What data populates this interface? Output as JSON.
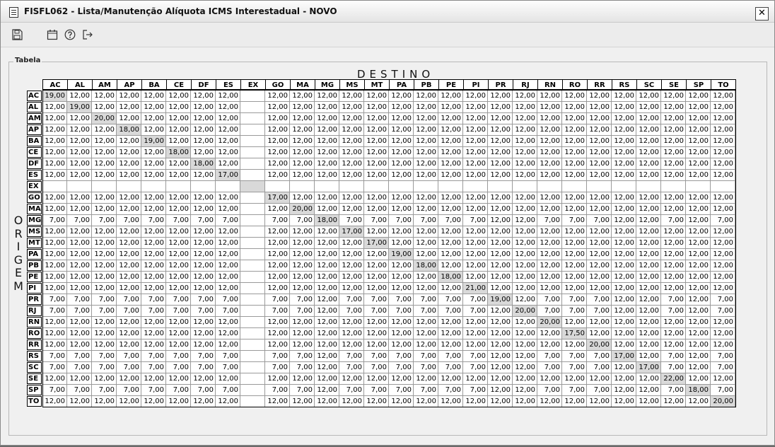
{
  "window": {
    "title": "FISFL062 - Lista/Manutenção Alíquota ICMS Interestadual - NOVO",
    "close_label": "✕"
  },
  "toolbar": {
    "icons": [
      "save-icon",
      "calendar-icon",
      "help-icon",
      "exit-icon"
    ]
  },
  "panel": {
    "legend": "Tabela",
    "destino_label": "DESTINO",
    "origem_letters": [
      "O",
      "R",
      "I",
      "G",
      "E",
      "M"
    ]
  },
  "states": [
    "AC",
    "AL",
    "AM",
    "AP",
    "BA",
    "CE",
    "DF",
    "ES",
    "EX",
    "GO",
    "MA",
    "MG",
    "MS",
    "MT",
    "PA",
    "PB",
    "PE",
    "PI",
    "PR",
    "RJ",
    "RN",
    "RO",
    "RR",
    "RS",
    "SC",
    "SE",
    "SP",
    "TO"
  ],
  "rows": [
    [
      "19,00",
      "12,00",
      "12,00",
      "12,00",
      "12,00",
      "12,00",
      "12,00",
      "12,00",
      "",
      "12,00",
      "12,00",
      "12,00",
      "12,00",
      "12,00",
      "12,00",
      "12,00",
      "12,00",
      "12,00",
      "12,00",
      "12,00",
      "12,00",
      "12,00",
      "12,00",
      "12,00",
      "12,00",
      "12,00",
      "12,00",
      "12,00"
    ],
    [
      "12,00",
      "19,00",
      "12,00",
      "12,00",
      "12,00",
      "12,00",
      "12,00",
      "12,00",
      "",
      "12,00",
      "12,00",
      "12,00",
      "12,00",
      "12,00",
      "12,00",
      "12,00",
      "12,00",
      "12,00",
      "12,00",
      "12,00",
      "12,00",
      "12,00",
      "12,00",
      "12,00",
      "12,00",
      "12,00",
      "12,00",
      "12,00"
    ],
    [
      "12,00",
      "12,00",
      "20,00",
      "12,00",
      "12,00",
      "12,00",
      "12,00",
      "12,00",
      "",
      "12,00",
      "12,00",
      "12,00",
      "12,00",
      "12,00",
      "12,00",
      "12,00",
      "12,00",
      "12,00",
      "12,00",
      "12,00",
      "12,00",
      "12,00",
      "12,00",
      "12,00",
      "12,00",
      "12,00",
      "12,00",
      "12,00"
    ],
    [
      "12,00",
      "12,00",
      "12,00",
      "18,00",
      "12,00",
      "12,00",
      "12,00",
      "12,00",
      "",
      "12,00",
      "12,00",
      "12,00",
      "12,00",
      "12,00",
      "12,00",
      "12,00",
      "12,00",
      "12,00",
      "12,00",
      "12,00",
      "12,00",
      "12,00",
      "12,00",
      "12,00",
      "12,00",
      "12,00",
      "12,00",
      "12,00"
    ],
    [
      "12,00",
      "12,00",
      "12,00",
      "12,00",
      "19,00",
      "12,00",
      "12,00",
      "12,00",
      "",
      "12,00",
      "12,00",
      "12,00",
      "12,00",
      "12,00",
      "12,00",
      "12,00",
      "12,00",
      "12,00",
      "12,00",
      "12,00",
      "12,00",
      "12,00",
      "12,00",
      "12,00",
      "12,00",
      "12,00",
      "12,00",
      "12,00"
    ],
    [
      "12,00",
      "12,00",
      "12,00",
      "12,00",
      "12,00",
      "18,00",
      "12,00",
      "12,00",
      "",
      "12,00",
      "12,00",
      "12,00",
      "12,00",
      "12,00",
      "12,00",
      "12,00",
      "12,00",
      "12,00",
      "12,00",
      "12,00",
      "12,00",
      "12,00",
      "12,00",
      "12,00",
      "12,00",
      "12,00",
      "12,00",
      "12,00"
    ],
    [
      "12,00",
      "12,00",
      "12,00",
      "12,00",
      "12,00",
      "12,00",
      "18,00",
      "12,00",
      "",
      "12,00",
      "12,00",
      "12,00",
      "12,00",
      "12,00",
      "12,00",
      "12,00",
      "12,00",
      "12,00",
      "12,00",
      "12,00",
      "12,00",
      "12,00",
      "12,00",
      "12,00",
      "12,00",
      "12,00",
      "12,00",
      "12,00"
    ],
    [
      "12,00",
      "12,00",
      "12,00",
      "12,00",
      "12,00",
      "12,00",
      "12,00",
      "17,00",
      "",
      "12,00",
      "12,00",
      "12,00",
      "12,00",
      "12,00",
      "12,00",
      "12,00",
      "12,00",
      "12,00",
      "12,00",
      "12,00",
      "12,00",
      "12,00",
      "12,00",
      "12,00",
      "12,00",
      "12,00",
      "12,00",
      "12,00"
    ],
    [
      "",
      "",
      "",
      "",
      "",
      "",
      "",
      "",
      "",
      "",
      "",
      "",
      "",
      "",
      "",
      "",
      "",
      "",
      "",
      "",
      "",
      "",
      "",
      "",
      "",
      "",
      "",
      ""
    ],
    [
      "12,00",
      "12,00",
      "12,00",
      "12,00",
      "12,00",
      "12,00",
      "12,00",
      "12,00",
      "",
      "17,00",
      "12,00",
      "12,00",
      "12,00",
      "12,00",
      "12,00",
      "12,00",
      "12,00",
      "12,00",
      "12,00",
      "12,00",
      "12,00",
      "12,00",
      "12,00",
      "12,00",
      "12,00",
      "12,00",
      "12,00",
      "12,00"
    ],
    [
      "12,00",
      "12,00",
      "12,00",
      "12,00",
      "12,00",
      "12,00",
      "12,00",
      "12,00",
      "",
      "12,00",
      "20,00",
      "12,00",
      "12,00",
      "12,00",
      "12,00",
      "12,00",
      "12,00",
      "12,00",
      "12,00",
      "12,00",
      "12,00",
      "12,00",
      "12,00",
      "12,00",
      "12,00",
      "12,00",
      "12,00",
      "12,00"
    ],
    [
      "7,00",
      "7,00",
      "7,00",
      "7,00",
      "7,00",
      "7,00",
      "7,00",
      "7,00",
      "",
      "7,00",
      "7,00",
      "18,00",
      "7,00",
      "7,00",
      "7,00",
      "7,00",
      "7,00",
      "7,00",
      "12,00",
      "12,00",
      "7,00",
      "7,00",
      "7,00",
      "12,00",
      "12,00",
      "7,00",
      "12,00",
      "7,00"
    ],
    [
      "12,00",
      "12,00",
      "12,00",
      "12,00",
      "12,00",
      "12,00",
      "12,00",
      "12,00",
      "",
      "12,00",
      "12,00",
      "12,00",
      "17,00",
      "12,00",
      "12,00",
      "12,00",
      "12,00",
      "12,00",
      "12,00",
      "12,00",
      "12,00",
      "12,00",
      "12,00",
      "12,00",
      "12,00",
      "12,00",
      "12,00",
      "12,00"
    ],
    [
      "12,00",
      "12,00",
      "12,00",
      "12,00",
      "12,00",
      "12,00",
      "12,00",
      "12,00",
      "",
      "12,00",
      "12,00",
      "12,00",
      "12,00",
      "17,00",
      "12,00",
      "12,00",
      "12,00",
      "12,00",
      "12,00",
      "12,00",
      "12,00",
      "12,00",
      "12,00",
      "12,00",
      "12,00",
      "12,00",
      "12,00",
      "12,00"
    ],
    [
      "12,00",
      "12,00",
      "12,00",
      "12,00",
      "12,00",
      "12,00",
      "12,00",
      "12,00",
      "",
      "12,00",
      "12,00",
      "12,00",
      "12,00",
      "12,00",
      "19,00",
      "12,00",
      "12,00",
      "12,00",
      "12,00",
      "12,00",
      "12,00",
      "12,00",
      "12,00",
      "12,00",
      "12,00",
      "12,00",
      "12,00",
      "12,00"
    ],
    [
      "12,00",
      "12,00",
      "12,00",
      "12,00",
      "12,00",
      "12,00",
      "12,00",
      "12,00",
      "",
      "12,00",
      "12,00",
      "12,00",
      "12,00",
      "12,00",
      "12,00",
      "18,00",
      "12,00",
      "12,00",
      "12,00",
      "12,00",
      "12,00",
      "12,00",
      "12,00",
      "12,00",
      "12,00",
      "12,00",
      "12,00",
      "12,00"
    ],
    [
      "12,00",
      "12,00",
      "12,00",
      "12,00",
      "12,00",
      "12,00",
      "12,00",
      "12,00",
      "",
      "12,00",
      "12,00",
      "12,00",
      "12,00",
      "12,00",
      "12,00",
      "12,00",
      "18,00",
      "12,00",
      "12,00",
      "12,00",
      "12,00",
      "12,00",
      "12,00",
      "12,00",
      "12,00",
      "12,00",
      "12,00",
      "12,00"
    ],
    [
      "12,00",
      "12,00",
      "12,00",
      "12,00",
      "12,00",
      "12,00",
      "12,00",
      "12,00",
      "",
      "12,00",
      "12,00",
      "12,00",
      "12,00",
      "12,00",
      "12,00",
      "12,00",
      "12,00",
      "21,00",
      "12,00",
      "12,00",
      "12,00",
      "12,00",
      "12,00",
      "12,00",
      "12,00",
      "12,00",
      "12,00",
      "12,00"
    ],
    [
      "7,00",
      "7,00",
      "7,00",
      "7,00",
      "7,00",
      "7,00",
      "7,00",
      "7,00",
      "",
      "7,00",
      "7,00",
      "12,00",
      "7,00",
      "7,00",
      "7,00",
      "7,00",
      "7,00",
      "7,00",
      "19,00",
      "12,00",
      "7,00",
      "7,00",
      "7,00",
      "12,00",
      "12,00",
      "7,00",
      "12,00",
      "7,00"
    ],
    [
      "7,00",
      "7,00",
      "7,00",
      "7,00",
      "7,00",
      "7,00",
      "7,00",
      "7,00",
      "",
      "7,00",
      "7,00",
      "12,00",
      "7,00",
      "7,00",
      "7,00",
      "7,00",
      "7,00",
      "7,00",
      "12,00",
      "20,00",
      "7,00",
      "7,00",
      "7,00",
      "12,00",
      "12,00",
      "7,00",
      "12,00",
      "7,00"
    ],
    [
      "12,00",
      "12,00",
      "12,00",
      "12,00",
      "12,00",
      "12,00",
      "12,00",
      "12,00",
      "",
      "12,00",
      "12,00",
      "12,00",
      "12,00",
      "12,00",
      "12,00",
      "12,00",
      "12,00",
      "12,00",
      "12,00",
      "12,00",
      "20,00",
      "12,00",
      "12,00",
      "12,00",
      "12,00",
      "12,00",
      "12,00",
      "12,00"
    ],
    [
      "12,00",
      "12,00",
      "12,00",
      "12,00",
      "12,00",
      "12,00",
      "12,00",
      "12,00",
      "",
      "12,00",
      "12,00",
      "12,00",
      "12,00",
      "12,00",
      "12,00",
      "12,00",
      "12,00",
      "12,00",
      "12,00",
      "12,00",
      "12,00",
      "17,50",
      "12,00",
      "12,00",
      "12,00",
      "12,00",
      "12,00",
      "12,00"
    ],
    [
      "12,00",
      "12,00",
      "12,00",
      "12,00",
      "12,00",
      "12,00",
      "12,00",
      "12,00",
      "",
      "12,00",
      "12,00",
      "12,00",
      "12,00",
      "12,00",
      "12,00",
      "12,00",
      "12,00",
      "12,00",
      "12,00",
      "12,00",
      "12,00",
      "12,00",
      "20,00",
      "12,00",
      "12,00",
      "12,00",
      "12,00",
      "12,00"
    ],
    [
      "7,00",
      "7,00",
      "7,00",
      "7,00",
      "7,00",
      "7,00",
      "7,00",
      "7,00",
      "",
      "7,00",
      "7,00",
      "12,00",
      "7,00",
      "7,00",
      "7,00",
      "7,00",
      "7,00",
      "7,00",
      "12,00",
      "12,00",
      "7,00",
      "7,00",
      "7,00",
      "17,00",
      "12,00",
      "7,00",
      "12,00",
      "7,00"
    ],
    [
      "7,00",
      "7,00",
      "7,00",
      "7,00",
      "7,00",
      "7,00",
      "7,00",
      "7,00",
      "",
      "7,00",
      "7,00",
      "12,00",
      "7,00",
      "7,00",
      "7,00",
      "7,00",
      "7,00",
      "7,00",
      "12,00",
      "12,00",
      "7,00",
      "7,00",
      "7,00",
      "12,00",
      "17,00",
      "7,00",
      "12,00",
      "7,00"
    ],
    [
      "12,00",
      "12,00",
      "12,00",
      "12,00",
      "12,00",
      "12,00",
      "12,00",
      "12,00",
      "",
      "12,00",
      "12,00",
      "12,00",
      "12,00",
      "12,00",
      "12,00",
      "12,00",
      "12,00",
      "12,00",
      "12,00",
      "12,00",
      "12,00",
      "12,00",
      "12,00",
      "12,00",
      "12,00",
      "22,00",
      "12,00",
      "12,00"
    ],
    [
      "7,00",
      "7,00",
      "7,00",
      "7,00",
      "7,00",
      "7,00",
      "7,00",
      "7,00",
      "",
      "7,00",
      "7,00",
      "12,00",
      "7,00",
      "7,00",
      "7,00",
      "7,00",
      "7,00",
      "7,00",
      "12,00",
      "12,00",
      "7,00",
      "7,00",
      "7,00",
      "12,00",
      "12,00",
      "7,00",
      "18,00",
      "7,00"
    ],
    [
      "12,00",
      "12,00",
      "12,00",
      "12,00",
      "12,00",
      "12,00",
      "12,00",
      "12,00",
      "",
      "12,00",
      "12,00",
      "12,00",
      "12,00",
      "12,00",
      "12,00",
      "12,00",
      "12,00",
      "12,00",
      "12,00",
      "12,00",
      "12,00",
      "12,00",
      "12,00",
      "12,00",
      "12,00",
      "12,00",
      "12,00",
      "20,00"
    ]
  ]
}
